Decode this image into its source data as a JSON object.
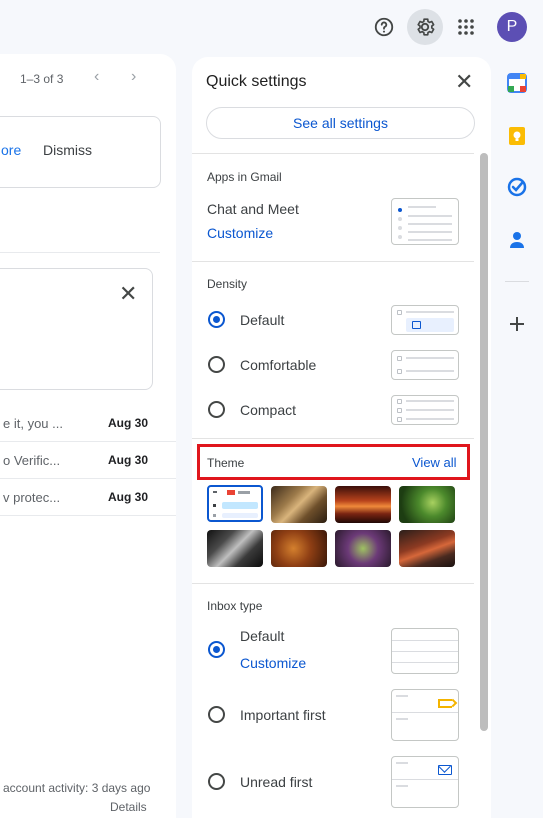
{
  "header": {
    "help_icon": "help-icon",
    "settings_icon": "gear-icon",
    "apps_icon": "apps-grid-icon",
    "avatar_letter": "P"
  },
  "mail": {
    "pager_text": "1–3 of 3",
    "notice": {
      "more_label": "ore",
      "dismiss_label": "Dismiss"
    },
    "rows": [
      {
        "snippet": "e it, you ...",
        "date": "Aug 30"
      },
      {
        "snippet": "o Verific...",
        "date": "Aug 30"
      },
      {
        "snippet": "v protec...",
        "date": "Aug 30"
      }
    ],
    "footer_activity": "account activity: 3 days ago",
    "footer_details": "Details"
  },
  "quick_settings": {
    "title": "Quick settings",
    "see_all": "See all settings",
    "apps": {
      "label": "Apps in Gmail",
      "item": "Chat and Meet",
      "customize": "Customize"
    },
    "density": {
      "label": "Density",
      "options": [
        {
          "label": "Default",
          "selected": true
        },
        {
          "label": "Comfortable",
          "selected": false
        },
        {
          "label": "Compact",
          "selected": false
        }
      ]
    },
    "theme": {
      "label": "Theme",
      "view_all": "View all"
    },
    "inbox": {
      "label": "Inbox type",
      "options": [
        {
          "label": "Default",
          "selected": true,
          "sub_link": "Customize"
        },
        {
          "label": "Important first",
          "selected": false
        },
        {
          "label": "Unread first",
          "selected": false
        }
      ]
    }
  },
  "colors": {
    "accent": "#0b57d0",
    "highlight": "#e0161d",
    "avatar": "#5c4fb4"
  }
}
